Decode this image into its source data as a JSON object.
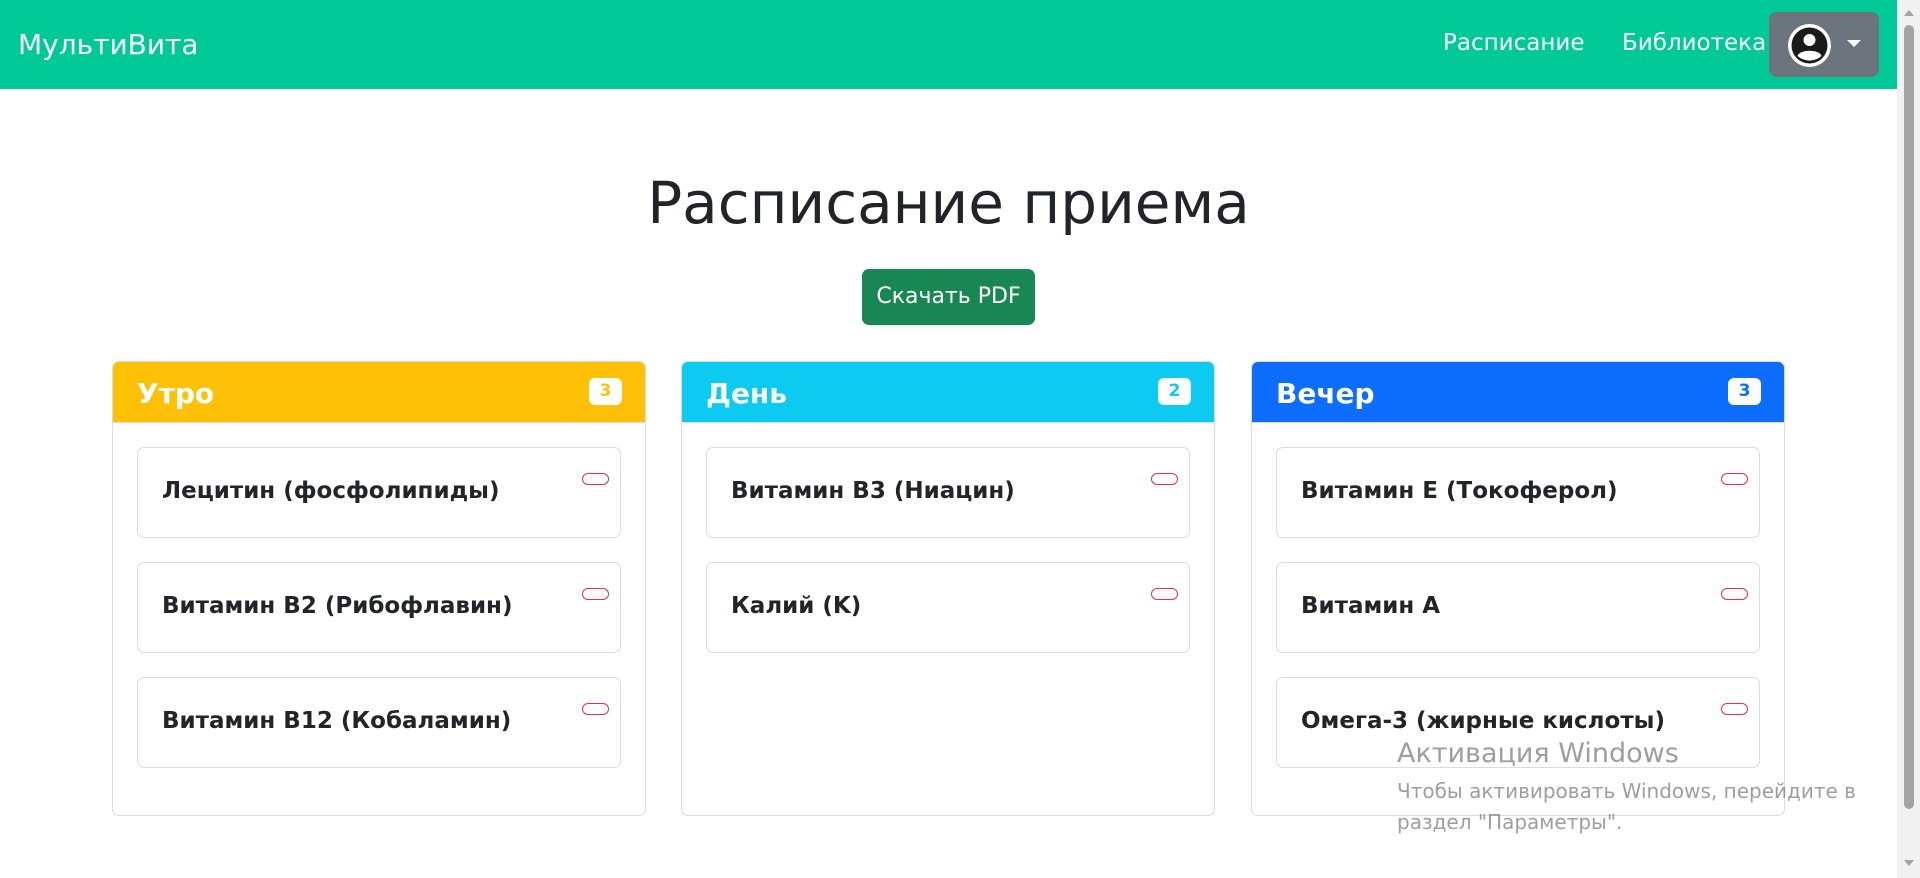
{
  "navbar": {
    "brand": "МультиВита",
    "links": [
      "Расписание",
      "Библиотека"
    ],
    "profile_icon": "user-circle-icon",
    "background": "#00c896"
  },
  "main": {
    "title": "Расписание приема",
    "download_button": "Скачать PDF",
    "columns": [
      {
        "title": "Утро",
        "count": "3",
        "color": "#ffc107",
        "items": [
          "Лецитин (фосфолипиды)",
          "Витамин B2 (Рибофлавин)",
          "Витамин B12 (Кобаламин)"
        ]
      },
      {
        "title": "День",
        "count": "2",
        "color": "#0dcaf0",
        "items": [
          "Витамин B3 (Ниацин)",
          "Калий (K)"
        ]
      },
      {
        "title": "Вечер",
        "count": "3",
        "color": "#0d6efd",
        "items": [
          "Витамин E (Токоферол)",
          "Витамин A",
          "Омега-3 (жирные кислоты)"
        ]
      }
    ]
  },
  "watermark": {
    "title": "Активация Windows",
    "text": "Чтобы активировать Windows, перейдите в раздел \"Параметры\"."
  }
}
